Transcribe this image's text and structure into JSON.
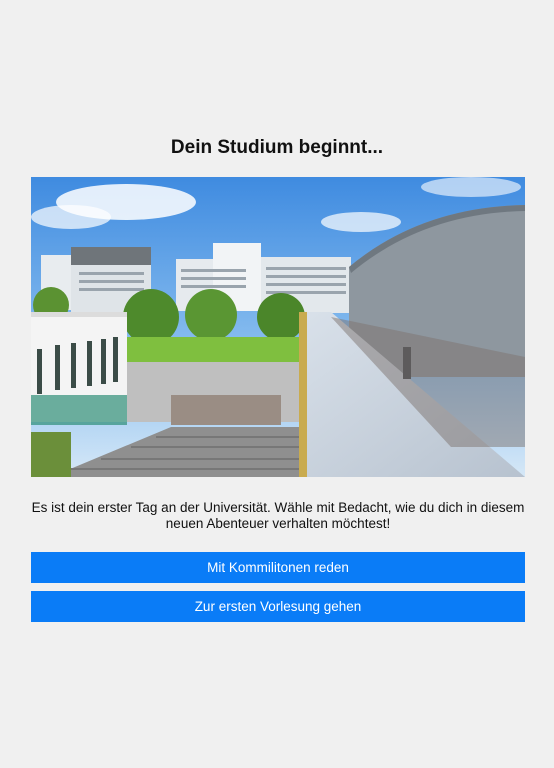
{
  "scene": {
    "title": "Dein Studium beginnt...",
    "image": {
      "subject": "university campus buildings under blue sky"
    },
    "description": "Es ist dein erster Tag an der Universität. Wähle mit Bedacht, wie du dich in diesem neuen Abenteuer verhalten möchtest!",
    "choices": [
      {
        "label": "Mit Kommilitonen reden"
      },
      {
        "label": "Zur ersten Vorlesung gehen"
      }
    ]
  },
  "colors": {
    "background": "#f0f0f0",
    "button": "#0a7cf7",
    "button_text": "#ffffff",
    "text": "#111111"
  }
}
